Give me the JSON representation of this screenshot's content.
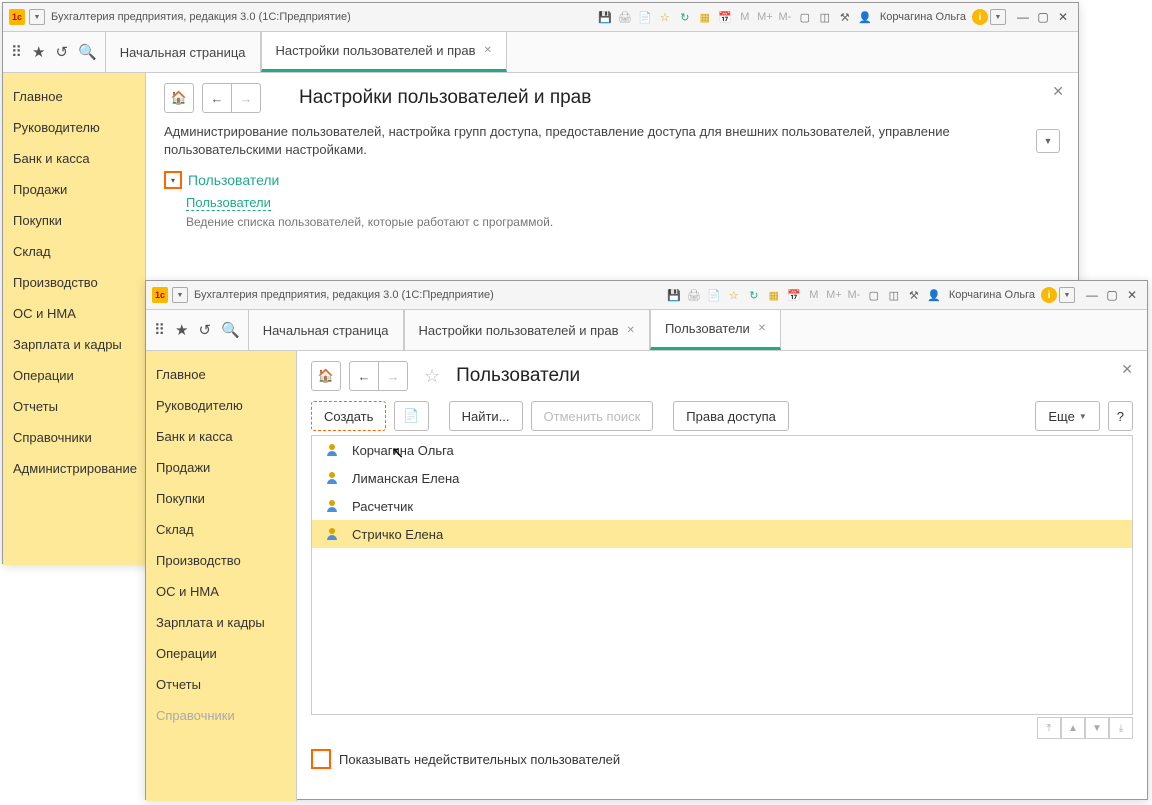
{
  "w1": {
    "title": "Бухгалтерия предприятия, редакция 3.0  (1С:Предприятие)",
    "user": "Корчагина Ольга",
    "tabs": {
      "start": "Начальная страница",
      "settings": "Настройки пользователей и прав"
    },
    "page": {
      "title": "Настройки пользователей и прав",
      "desc": "Администрирование пользователей, настройка групп доступа, предоставление доступа для внешних пользователей, управление пользовательскими настройками.",
      "section": "Пользователи",
      "link": "Пользователи",
      "subdesc": "Ведение списка пользователей, которые работают с программой."
    }
  },
  "w2": {
    "title": "Бухгалтерия предприятия, редакция 3.0  (1С:Предприятие)",
    "user": "Корчагина Ольга",
    "tabs": {
      "start": "Начальная страница",
      "settings": "Настройки пользователей и прав",
      "users": "Пользователи"
    },
    "page": {
      "title": "Пользователи",
      "btn_create": "Создать",
      "btn_find": "Найти...",
      "btn_cancel": "Отменить поиск",
      "btn_rights": "Права доступа",
      "btn_more": "Еще",
      "footer": "Показывать недействительных пользователей"
    },
    "users": [
      "Корчагина Ольга",
      "Лиманская Елена",
      "Расчетчик",
      "Стричко Елена"
    ]
  },
  "sidebar": {
    "items": [
      "Главное",
      "Руководителю",
      "Банк и касса",
      "Продажи",
      "Покупки",
      "Склад",
      "Производство",
      "ОС и НМА",
      "Зарплата и кадры",
      "Операции",
      "Отчеты",
      "Справочники",
      "Администрирование"
    ]
  },
  "tb_m": {
    "m": "M",
    "mp": "M+",
    "mm": "M-"
  }
}
